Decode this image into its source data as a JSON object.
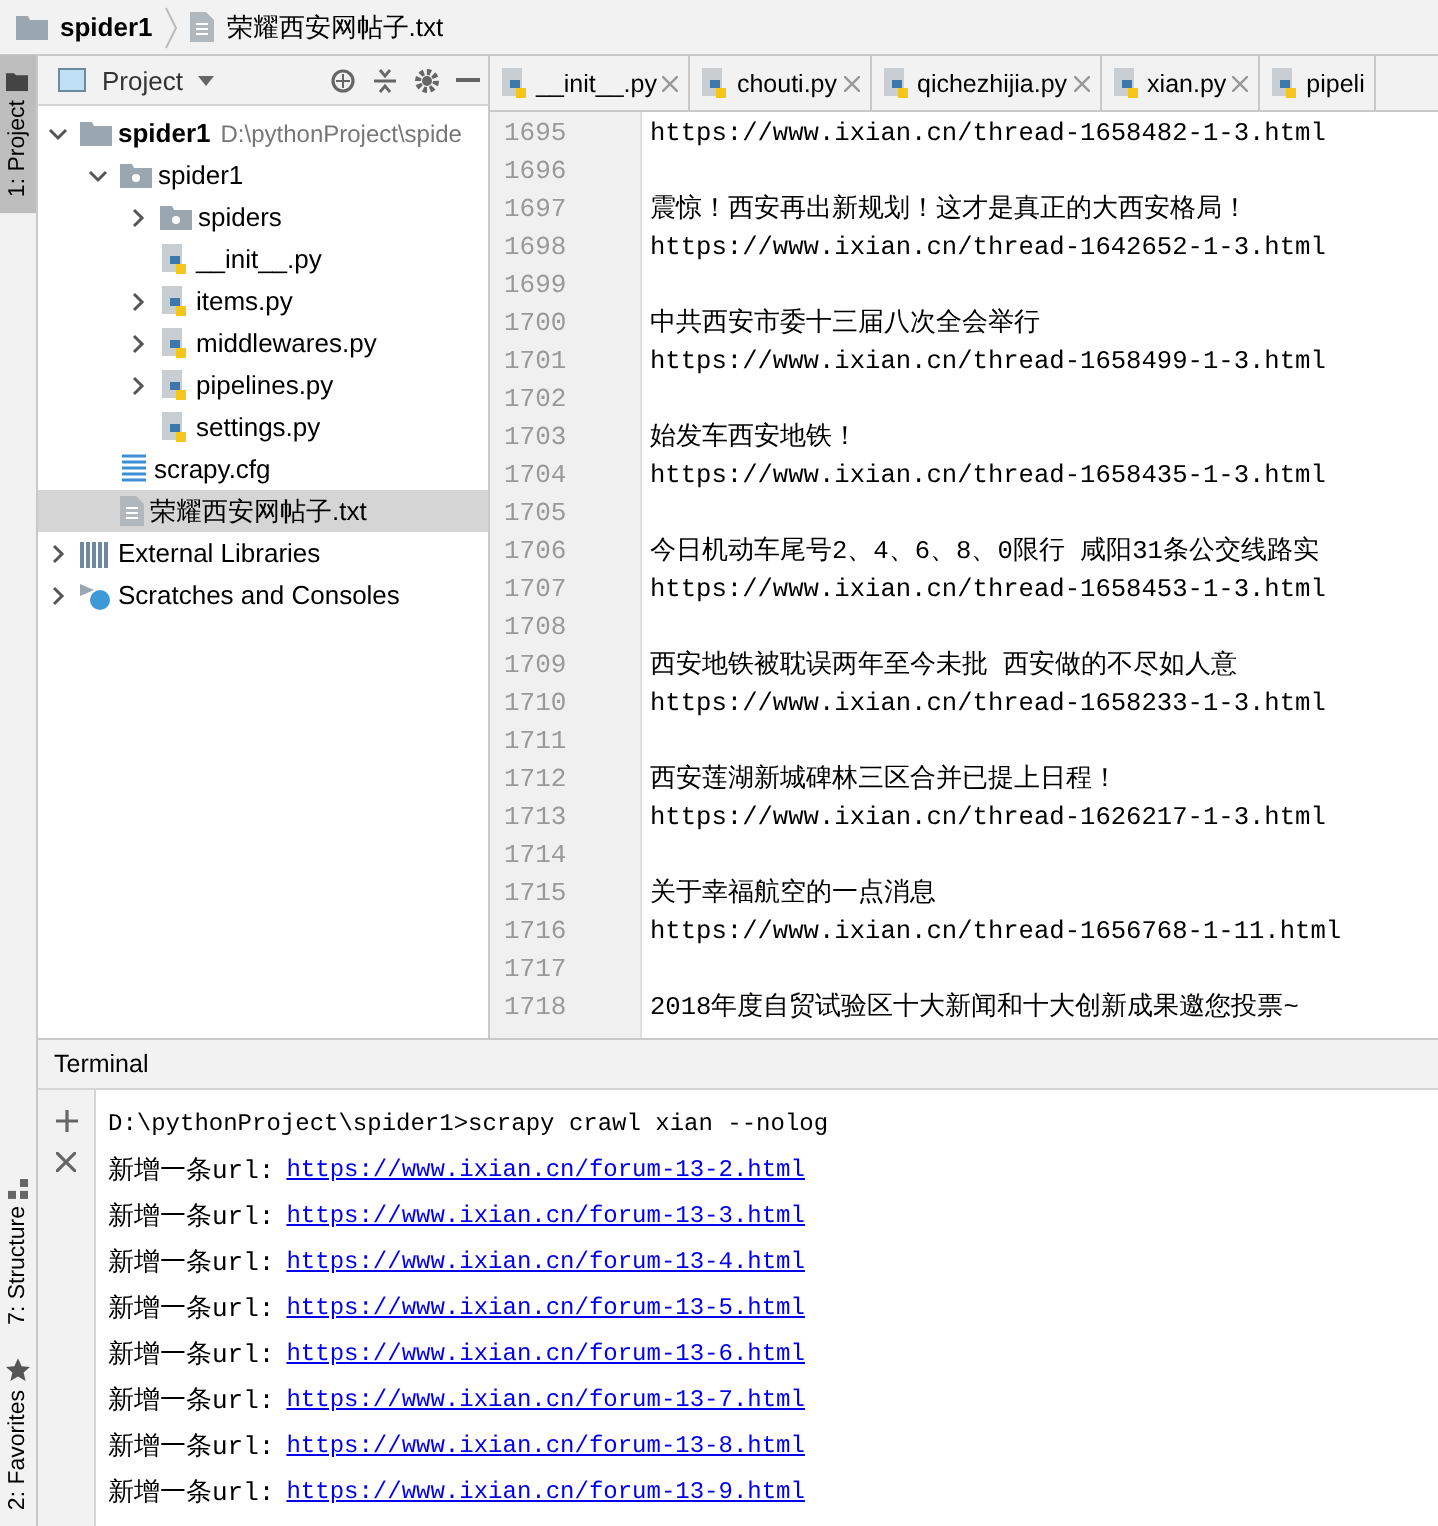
{
  "breadcrumb": [
    {
      "kind": "folder",
      "label": "spider1"
    },
    {
      "kind": "txt",
      "label": "荣耀西安网帖子.txt"
    }
  ],
  "side_tabs": [
    {
      "kind": "project",
      "label": "1: Project",
      "selected": true
    },
    {
      "kind": "structure",
      "label": "7: Structure",
      "selected": false
    },
    {
      "kind": "favorites",
      "label": "2: Favorites",
      "selected": false
    }
  ],
  "project_panel": {
    "title": "Project",
    "tree": [
      {
        "kind": "root",
        "label": "spider1",
        "path": "D:\\pythonProject\\spide",
        "expanded": true,
        "selected": false,
        "children": [
          {
            "kind": "module",
            "label": "spider1",
            "expanded": true,
            "selected": false,
            "children": [
              {
                "kind": "module",
                "label": "spiders",
                "expanded": false,
                "selected": false
              },
              {
                "kind": "python",
                "label": "__init__.py",
                "selected": false
              },
              {
                "kind": "python",
                "label": "items.py",
                "expanded": false,
                "selected": false
              },
              {
                "kind": "python",
                "label": "middlewares.py",
                "expanded": false,
                "selected": false
              },
              {
                "kind": "python",
                "label": "pipelines.py",
                "expanded": false,
                "selected": false
              },
              {
                "kind": "python",
                "label": "settings.py",
                "selected": false
              }
            ]
          },
          {
            "kind": "cfg",
            "label": "scrapy.cfg",
            "selected": false
          },
          {
            "kind": "txt",
            "label": "荣耀西安网帖子.txt",
            "selected": true
          }
        ]
      },
      {
        "kind": "libraries",
        "label": "External Libraries",
        "expanded": false,
        "selected": false
      },
      {
        "kind": "scratches",
        "label": "Scratches and Consoles",
        "expanded": false,
        "selected": false
      }
    ]
  },
  "editor_tabs": [
    {
      "label": "__init__.py"
    },
    {
      "label": "chouti.py"
    },
    {
      "label": "qichezhijia.py"
    },
    {
      "label": "xian.py"
    },
    {
      "label": "pipeli"
    }
  ],
  "editor_lines": [
    {
      "number": "1695",
      "text": "https://www.ixian.cn/thread-1658482-1-3.html"
    },
    {
      "number": "1696"
    },
    {
      "number": "1697",
      "text": "震惊！西安再出新规划！这才是真正的大西安格局！"
    },
    {
      "number": "1698",
      "text": "https://www.ixian.cn/thread-1642652-1-3.html"
    },
    {
      "number": "1699"
    },
    {
      "number": "1700",
      "text": "中共西安市委十三届八次全会举行"
    },
    {
      "number": "1701",
      "text": "https://www.ixian.cn/thread-1658499-1-3.html"
    },
    {
      "number": "1702"
    },
    {
      "number": "1703",
      "text": "始发车西安地铁！"
    },
    {
      "number": "1704",
      "text": "https://www.ixian.cn/thread-1658435-1-3.html"
    },
    {
      "number": "1705"
    },
    {
      "number": "1706",
      "text": "今日机动车尾号2、4、6、8、0限行 咸阳31条公交线路实"
    },
    {
      "number": "1707",
      "text": "https://www.ixian.cn/thread-1658453-1-3.html"
    },
    {
      "number": "1708"
    },
    {
      "number": "1709",
      "text": "西安地铁被耽误两年至今未批 西安做的不尽如人意"
    },
    {
      "number": "1710",
      "text": "https://www.ixian.cn/thread-1658233-1-3.html"
    },
    {
      "number": "1711"
    },
    {
      "number": "1712",
      "text": "西安莲湖新城碑林三区合并已提上日程！"
    },
    {
      "number": "1713",
      "text": "https://www.ixian.cn/thread-1626217-1-3.html"
    },
    {
      "number": "1714"
    },
    {
      "number": "1715",
      "text": "关于幸福航空的一点消息"
    },
    {
      "number": "1716",
      "text": "https://www.ixian.cn/thread-1656768-1-11.html"
    },
    {
      "number": "1717"
    },
    {
      "number": "1718",
      "text": "2018年度自贸试验区十大新闻和十大创新成果邀您投票~"
    }
  ],
  "terminal": {
    "title": "Terminal",
    "command": "D:\\pythonProject\\spider1>scrapy crawl xian --nolog",
    "lines": [
      {
        "prefix": "新增一条url:",
        "url": "https://www.ixian.cn/forum-13-2.html"
      },
      {
        "prefix": "新增一条url:",
        "url": "https://www.ixian.cn/forum-13-3.html"
      },
      {
        "prefix": "新增一条url:",
        "url": "https://www.ixian.cn/forum-13-4.html"
      },
      {
        "prefix": "新增一条url:",
        "url": "https://www.ixian.cn/forum-13-5.html"
      },
      {
        "prefix": "新增一条url:",
        "url": "https://www.ixian.cn/forum-13-6.html"
      },
      {
        "prefix": "新增一条url:",
        "url": "https://www.ixian.cn/forum-13-7.html"
      },
      {
        "prefix": "新增一条url:",
        "url": "https://www.ixian.cn/forum-13-8.html"
      },
      {
        "prefix": "新增一条url:",
        "url": "https://www.ixian.cn/forum-13-9.html"
      }
    ]
  }
}
